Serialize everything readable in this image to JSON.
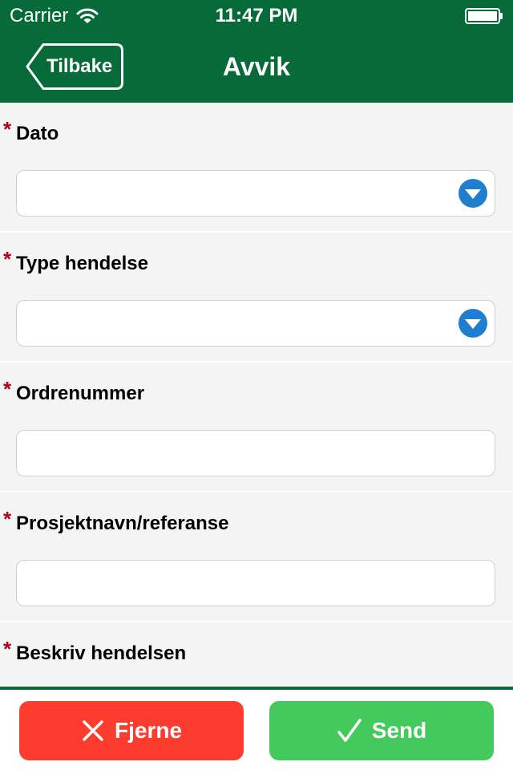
{
  "status_bar": {
    "carrier": "Carrier",
    "time": "11:47 PM"
  },
  "nav": {
    "back_label": "Tilbake",
    "title": "Avvik"
  },
  "form": {
    "required_marker": "*",
    "fields": [
      {
        "label": "Dato",
        "type": "dropdown",
        "value": ""
      },
      {
        "label": "Type hendelse",
        "type": "dropdown",
        "value": ""
      },
      {
        "label": "Ordrenummer",
        "type": "text",
        "value": ""
      },
      {
        "label": "Prosjektnavn/referanse",
        "type": "text",
        "value": ""
      },
      {
        "label": "Beskriv hendelsen",
        "type": "textarea",
        "value": ""
      }
    ]
  },
  "actions": {
    "remove_label": "Fjerne",
    "send_label": "Send"
  },
  "colors": {
    "header": "#066b38",
    "required": "#b1001b",
    "dropdown_icon": "#1f7fce",
    "remove_button": "#fd3c30",
    "send_button": "#44c95c"
  },
  "icons": [
    "wifi-icon",
    "battery-icon",
    "back-arrow-icon",
    "chevron-down-icon",
    "close-icon",
    "checkmark-icon"
  ]
}
